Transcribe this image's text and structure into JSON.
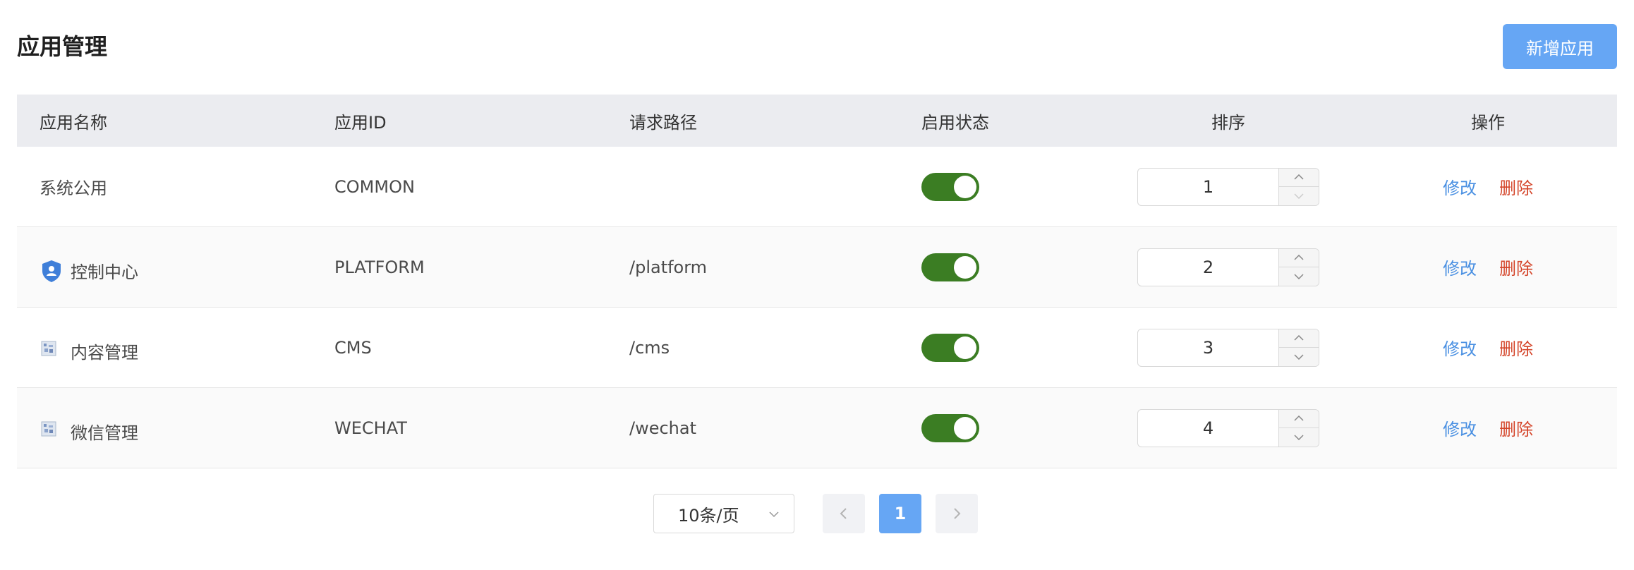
{
  "header": {
    "title": "应用管理",
    "add_button": "新增应用"
  },
  "table": {
    "columns": [
      "应用名称",
      "应用ID",
      "请求路径",
      "启用状态",
      "排序",
      "操作"
    ],
    "rows": [
      {
        "name": "系统公用",
        "icon": "none",
        "id": "COMMON",
        "path": "",
        "enabled": true,
        "order": "1",
        "edit": "修改",
        "delete": "删除"
      },
      {
        "name": "控制中心",
        "icon": "shield-user-icon",
        "id": "PLATFORM",
        "path": "/platform",
        "enabled": true,
        "order": "2",
        "edit": "修改",
        "delete": "删除"
      },
      {
        "name": "内容管理",
        "icon": "broken-image-icon",
        "id": "CMS",
        "path": "/cms",
        "enabled": true,
        "order": "3",
        "edit": "修改",
        "delete": "删除"
      },
      {
        "name": "微信管理",
        "icon": "broken-image-icon",
        "id": "WECHAT",
        "path": "/wechat",
        "enabled": true,
        "order": "4",
        "edit": "修改",
        "delete": "删除"
      }
    ]
  },
  "pagination": {
    "page_size": "10条/页",
    "current_page": "1"
  },
  "colors": {
    "primary": "#66a6f4",
    "switch_on": "#3b7d23",
    "edit_link": "#4a90e2",
    "delete_link": "#d4452a",
    "header_bg": "#ebecf0"
  }
}
